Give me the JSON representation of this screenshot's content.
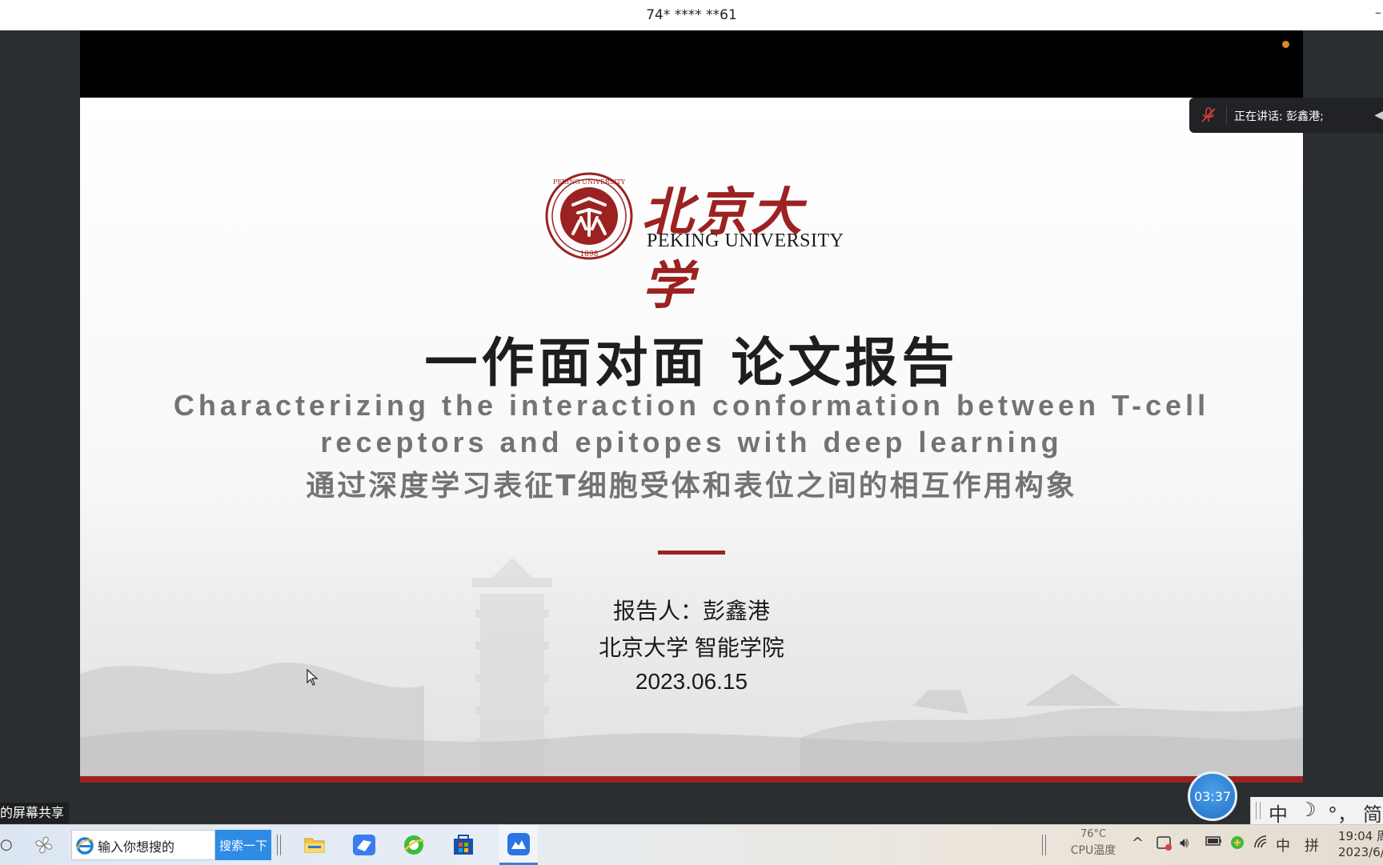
{
  "window": {
    "title": "74* **** **61"
  },
  "speaking": {
    "label": "正在讲话: 彭鑫港;"
  },
  "slide": {
    "logo": {
      "name_cn": "北京大学",
      "name_en": "PEKING UNIVERSITY",
      "seal_text": "PEKING UNIVERSITY",
      "seal_year": "1898"
    },
    "title": "一作面对面 论文报告",
    "paper_title_en_line1": "Characterizing the interaction conformation between T-cell",
    "paper_title_en_line2": "receptors and epitopes with deep learning",
    "paper_title_cn": "通过深度学习表征T细胞受体和表位之间的相互作用构象",
    "presenter": "报告人：彭鑫港",
    "institution": "北京大学 智能学院",
    "date": "2023.06.15"
  },
  "share_caption": "的屏幕共享",
  "timer": "03:37",
  "ime_toolbar": {
    "mode": "中",
    "moon": "☽",
    "punct": "°，",
    "script": "简"
  },
  "taskbar": {
    "search_value": "输入你想搜的",
    "search_button": "搜索一下",
    "apps": [
      "pinwheel-app",
      "file-explorer",
      "feishu",
      "browser-360",
      "microsoft-store",
      "meeting-app"
    ]
  },
  "tray": {
    "temperature": "76°C",
    "temperature_label": "CPU温度",
    "ime_mode": "中",
    "ime_pinyin": "拼"
  },
  "clock": {
    "time": "19:04 周",
    "date": "2023/6/"
  },
  "colors": {
    "pku_red": "#9b2221",
    "timer_blue": "#2f7fd1",
    "search_blue": "#2e8ce6"
  }
}
